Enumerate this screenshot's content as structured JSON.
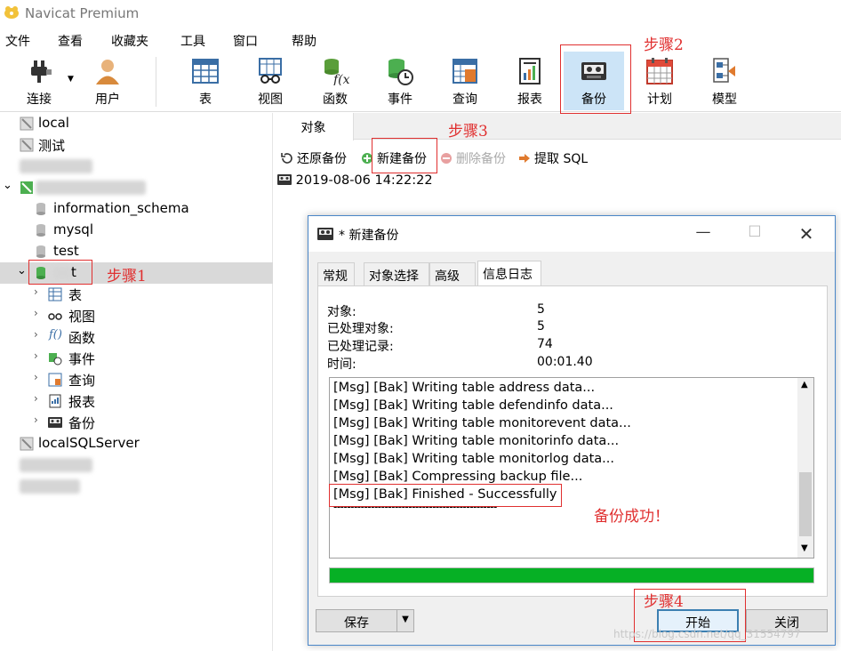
{
  "app": {
    "title": "Navicat Premium"
  },
  "menu": [
    "文件",
    "查看",
    "收藏夹",
    "工具",
    "窗口",
    "帮助"
  ],
  "toolbar": {
    "connect": "连接",
    "user": "用户",
    "table": "表",
    "view": "视图",
    "function": "函数",
    "event": "事件",
    "query": "查询",
    "report": "报表",
    "backup": "备份",
    "schedule": "计划",
    "model": "模型"
  },
  "annotations": {
    "step1": "步骤1",
    "step2": "步骤2",
    "step3": "步骤3",
    "step4": "步骤4",
    "success": "备份成功！"
  },
  "sidebar": {
    "local": "local",
    "test_conn": "测试",
    "db1": "information_schema",
    "db2": "mysql",
    "db3": "test",
    "db_sel": "t",
    "children": [
      "表",
      "视图",
      "函数",
      "事件",
      "查询",
      "报表",
      "备份"
    ],
    "sqlserver": "localSQLServer"
  },
  "main": {
    "tab": "对象",
    "restore": "还原备份",
    "new_backup": "新建备份",
    "delete_backup": "删除备份",
    "extract_sql": "提取 SQL",
    "backup_item": "2019-08-06 14:22:22"
  },
  "dialog": {
    "title": "* 新建备份",
    "tabs": [
      "常规",
      "对象选择",
      "高级",
      "信息日志"
    ],
    "info": [
      {
        "label": "对象:",
        "value": "5"
      },
      {
        "label": "已处理对象:",
        "value": "5"
      },
      {
        "label": "已处理记录:",
        "value": "74"
      },
      {
        "label": "时间:",
        "value": "00:01.40"
      }
    ],
    "log": [
      "[Msg] [Bak] Writing table address data...",
      "[Msg] [Bak] Writing table defendinfo data...",
      "[Msg] [Bak] Writing table monitorevent data...",
      "[Msg] [Bak] Writing table monitorinfo data...",
      "[Msg] [Bak] Writing table monitorlog data...",
      "[Msg] [Bak] Compressing backup file...",
      "[Msg] [Bak] Finished - Successfully",
      "------------------------------------------------"
    ],
    "progress": 1.0,
    "save": "保存",
    "start": "开始",
    "close": "关闭"
  },
  "watermark": "https://blog.csdn.net/qq_31554797",
  "colors": {
    "annotation": "#e03030",
    "progress": "#06b025",
    "selection": "#cce4f7"
  }
}
